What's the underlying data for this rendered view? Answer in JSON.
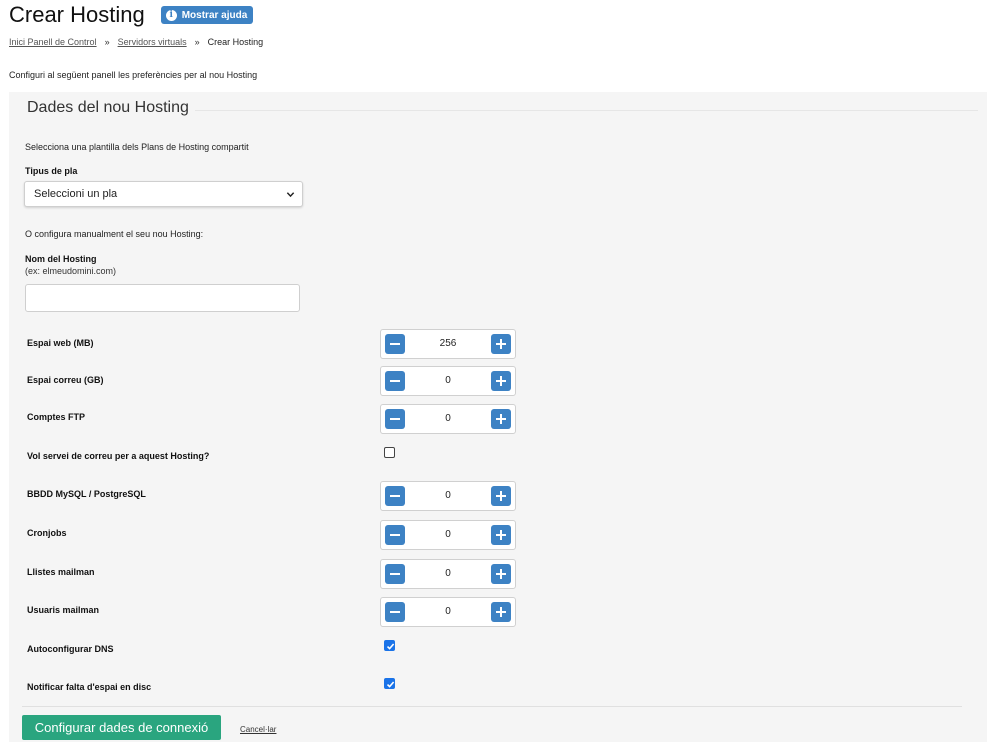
{
  "header": {
    "title": "Crear Hosting",
    "help_button": "Mostrar ajuda",
    "help_icon": "info-icon"
  },
  "breadcrumb": {
    "items": [
      "Inici Panell de Control",
      "Servidors virtuals",
      "Crear Hosting"
    ],
    "separator": "»"
  },
  "intro": "Configuri al següent panell les preferències per al nou Hosting",
  "panel": {
    "legend": "Dades del nou Hosting",
    "template_prompt": "Selecciona una plantilla dels Plans de Hosting compartit",
    "plan_type_label": "Tipus de pla",
    "plan_select_value": "Seleccioni un pla",
    "manual_prompt": "O configura manualment el seu nou Hosting:",
    "hosting_name_label": "Nom del Hosting",
    "hosting_name_hint": "(ex: elmeudomini.com)",
    "hosting_name_value": ""
  },
  "fields": [
    {
      "label": "Espai web (MB)",
      "type": "stepper",
      "value": "256"
    },
    {
      "label": "Espai correu (GB)",
      "type": "stepper",
      "value": "0"
    },
    {
      "label": "Comptes FTP",
      "type": "stepper",
      "value": "0"
    },
    {
      "label": "Vol servei de correu per a aquest Hosting?",
      "type": "checkbox",
      "checked": false
    },
    {
      "label": "BBDD MySQL / PostgreSQL",
      "type": "stepper",
      "value": "0"
    },
    {
      "label": "Cronjobs",
      "type": "stepper",
      "value": "0"
    },
    {
      "label": "Llistes mailman",
      "type": "stepper",
      "value": "0"
    },
    {
      "label": "Usuaris mailman",
      "type": "stepper",
      "value": "0"
    },
    {
      "label": "Autoconfigurar DNS",
      "type": "checkbox",
      "checked": true
    },
    {
      "label": "Notificar falta d'espai en disc",
      "type": "checkbox",
      "checked": true
    }
  ],
  "actions": {
    "submit": "Configurar dades de connexió",
    "cancel": "Cancel·lar"
  },
  "colors": {
    "accent": "#3d82c4",
    "submit": "#2aa57f",
    "checkbox": "#1a73e8",
    "panel_bg": "#f5f5f5"
  }
}
